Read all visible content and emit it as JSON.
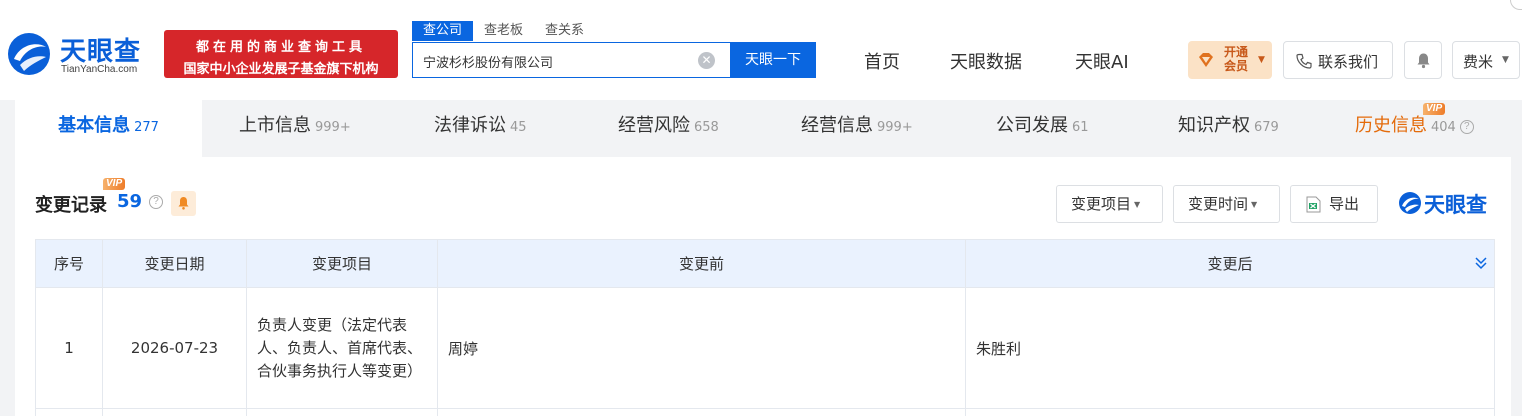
{
  "header": {
    "logo": {
      "name_cn": "天眼查",
      "name_en": "TianYanCha.com",
      "brand_color": "#0a5fd8"
    },
    "slogan": {
      "line1": "都在用的商业查询工具",
      "line2": "国家中小企业发展子基金旗下机构",
      "bg_color": "#d6262a"
    },
    "search_tabs": [
      "查公司",
      "查老板",
      "查关系"
    ],
    "search": {
      "value": "宁波杉杉股份有限公司",
      "button": "天眼一下",
      "clear_icon": "clear-icon"
    },
    "nav": [
      "首页",
      "天眼数据",
      "天眼AI"
    ],
    "vip_button": {
      "line1": "开通",
      "line2": "会员"
    },
    "contact_button": "联系我们",
    "bell_icon": "bell-icon",
    "user_button": "费米"
  },
  "tabs": [
    {
      "label": "基本信息",
      "count": "277",
      "active": true
    },
    {
      "label": "上市信息",
      "count": "999+"
    },
    {
      "label": "法律诉讼",
      "count": "45"
    },
    {
      "label": "经营风险",
      "count": "658"
    },
    {
      "label": "经营信息",
      "count": "999+"
    },
    {
      "label": "公司发展",
      "count": "61"
    },
    {
      "label": "知识产权",
      "count": "679"
    },
    {
      "label": "历史信息",
      "count": "404",
      "vip": "VIP"
    }
  ],
  "section": {
    "vip": "VIP",
    "title": "变更记录",
    "count": "59",
    "filters": {
      "item": "变更项目",
      "time": "变更时间",
      "export": "导出"
    },
    "brand": "天眼查"
  },
  "table": {
    "headers": [
      "序号",
      "变更日期",
      "变更项目",
      "变更前",
      "变更后"
    ],
    "rows": [
      {
        "no": "1",
        "date": "2026-07-23",
        "item": "负责人变更（法定代表人、负责人、首席代表、合伙事务执行人等变更）",
        "before": "周婷",
        "after": "朱胜利"
      }
    ]
  },
  "colors": {
    "accent": "#0a66e0",
    "history_tab": "#e46b0b",
    "vip_orange": "#ee7c2a"
  }
}
